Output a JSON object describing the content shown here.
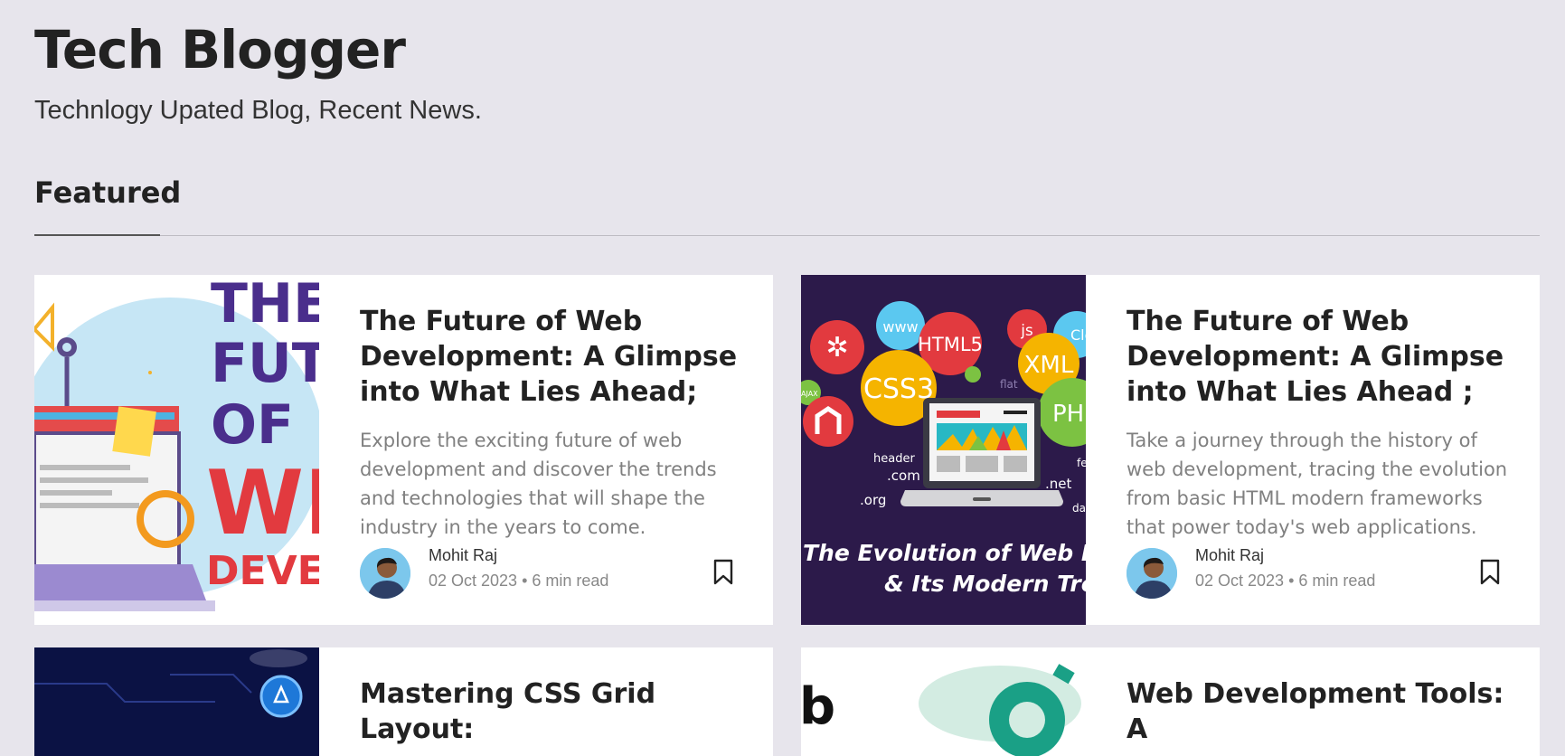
{
  "site": {
    "title": "Tech Blogger",
    "tagline": "Technlogy Upated Blog, Recent News."
  },
  "featured": {
    "heading": "Featured",
    "cards": [
      {
        "title": "The Future of Web Development: A Glimpse into What Lies Ahead;",
        "excerpt": "Explore the exciting future of web development and discover the trends and technologies that will shape the industry in the years to come.",
        "author": "Mohit Raj",
        "meta": "02 Oct 2023 • 6 min read",
        "image_text": [
          "THE",
          "FUT",
          "OF",
          "WE",
          "DEVE"
        ]
      },
      {
        "title": "The Future of Web Development: A Glimpse into What Lies Ahead ;",
        "excerpt": "Take a journey through the history of web development, tracing the evolution from basic HTML modern frameworks that power today's web applications.",
        "author": "Mohit Raj",
        "meta": "02 Oct 2023 • 6 min read",
        "image_text": {
          "bubbles": [
            "www",
            "HTML5",
            "js",
            "Clo",
            "XML",
            "CSS3",
            "PH",
            "AJAX"
          ],
          "labels": [
            "header",
            ".com",
            ".org",
            "flat",
            ".net",
            "da",
            "fe"
          ],
          "caption_line1": "The Evolution of Web Deve",
          "caption_line2": "& Its Modern Trend"
        }
      },
      {
        "title": "Mastering CSS Grid Layout:"
      },
      {
        "title": "Web Development Tools: A",
        "image_text": "b"
      }
    ]
  },
  "colors": {
    "page_bg": "#e7e5ec",
    "card_bg": "#ffffff",
    "thumb2_bg": "#2c1a4a",
    "thumb3_bg": "#0b1244"
  }
}
